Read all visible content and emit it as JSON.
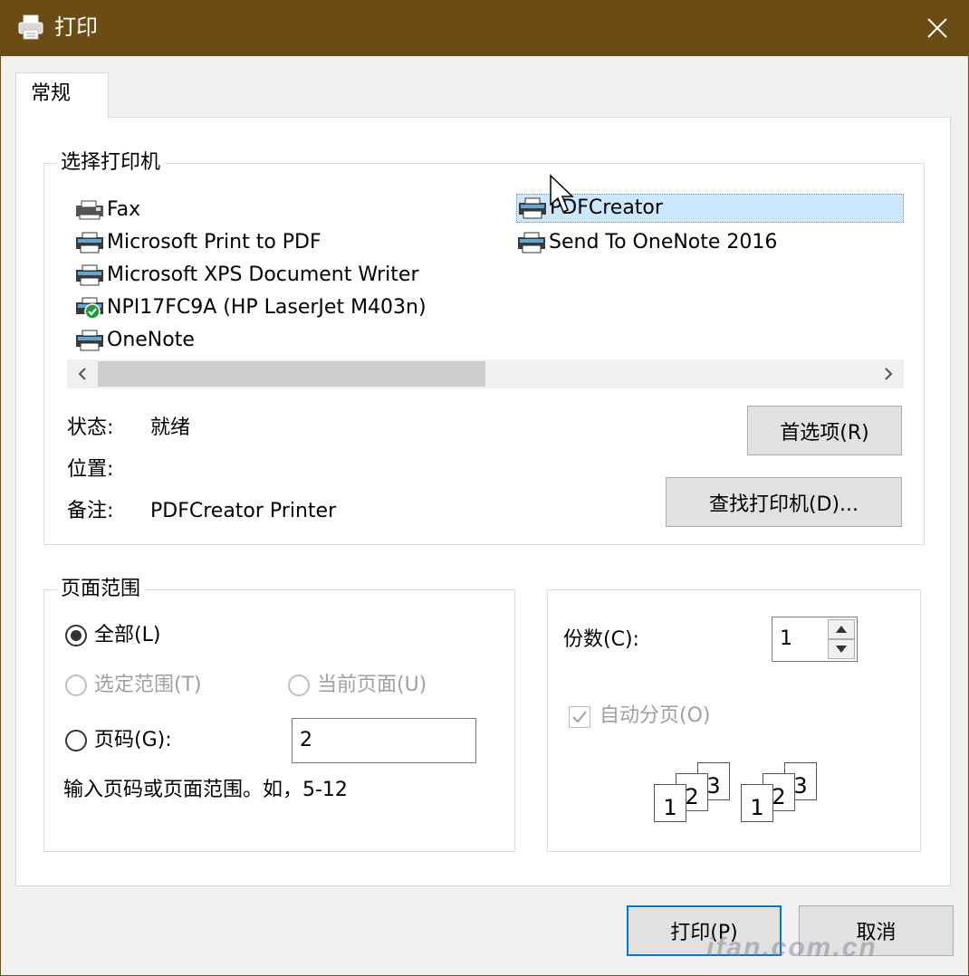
{
  "window": {
    "title": "打印"
  },
  "tabs": [
    {
      "label": "常规"
    }
  ],
  "printer_group": {
    "title": "选择打印机",
    "printers": [
      {
        "name": "Fax",
        "icon": "fax-icon",
        "selected": false
      },
      {
        "name": "Microsoft Print to PDF",
        "icon": "printer-icon",
        "selected": false
      },
      {
        "name": "Microsoft XPS Document Writer",
        "icon": "printer-icon",
        "selected": false
      },
      {
        "name": "NPI17FC9A (HP LaserJet M403n)",
        "icon": "printer-default-icon",
        "selected": false
      },
      {
        "name": "OneNote",
        "icon": "printer-icon",
        "selected": false
      },
      {
        "name": "PDFCreator",
        "icon": "printer-icon",
        "selected": true
      },
      {
        "name": "Send To OneNote 2016",
        "icon": "printer-icon",
        "selected": false
      }
    ],
    "status_label": "状态:",
    "status_value": "就绪",
    "location_label": "位置:",
    "location_value": "",
    "comment_label": "备注:",
    "comment_value": "PDFCreator Printer",
    "preferences_button": "首选项(R)",
    "find_printer_button": "查找打印机(D)..."
  },
  "page_range": {
    "title": "页面范围",
    "all_label": "全部(L)",
    "selection_label": "选定范围(T)",
    "current_page_label": "当前页面(U)",
    "pages_label": "页码(G):",
    "pages_value": "2",
    "hint": "输入页码或页面范围。如，5-12",
    "selected": "all"
  },
  "copies": {
    "label": "份数(C):",
    "value": "1",
    "collate_label": "自动分页(O)",
    "collate_checked": true,
    "collate_pages": [
      "1",
      "2",
      "3"
    ]
  },
  "footer": {
    "print_button": "打印(P)",
    "cancel_button": "取消"
  },
  "watermark": "ifan.com.cn",
  "colors": {
    "titlebar": "#6b4c15",
    "selection": "#cce8ff",
    "default_button_border": "#0078d7"
  }
}
